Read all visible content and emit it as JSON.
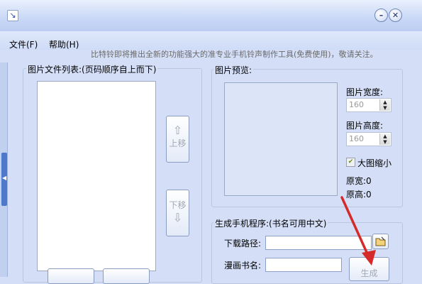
{
  "window": {
    "title": "",
    "minimize_glyph": "–",
    "close_glyph": "✕"
  },
  "menu": {
    "file": "文件(F)",
    "help": "帮助(H)"
  },
  "notice": "比特铃即将推出全新的功能强大的准专业手机铃声制作工具(免费使用)，敬请关注。",
  "image_list": {
    "legend": "图片文件列表:(页码顺序自上而下)",
    "up_arrow": "⇧",
    "up_label": "上移",
    "down_label": "下移",
    "down_arrow": "⇩"
  },
  "preview": {
    "legend": "图片预览:",
    "width_label": "图片宽度:",
    "width_value": "160",
    "height_label": "图片高度:",
    "height_value": "160",
    "shrink_label": "大图缩小",
    "shrink_checked": true,
    "orig_width": "原宽:0",
    "orig_height": "原高:0"
  },
  "generate": {
    "legend": "生成手机程序:(书名可用中文)",
    "path_label": "下载路径:",
    "path_value": "",
    "name_label": "漫画书名:",
    "name_value": "",
    "button_label": "生成"
  },
  "icons": {
    "browse": "folder-icon",
    "arrow_color": "#d62a2a"
  }
}
